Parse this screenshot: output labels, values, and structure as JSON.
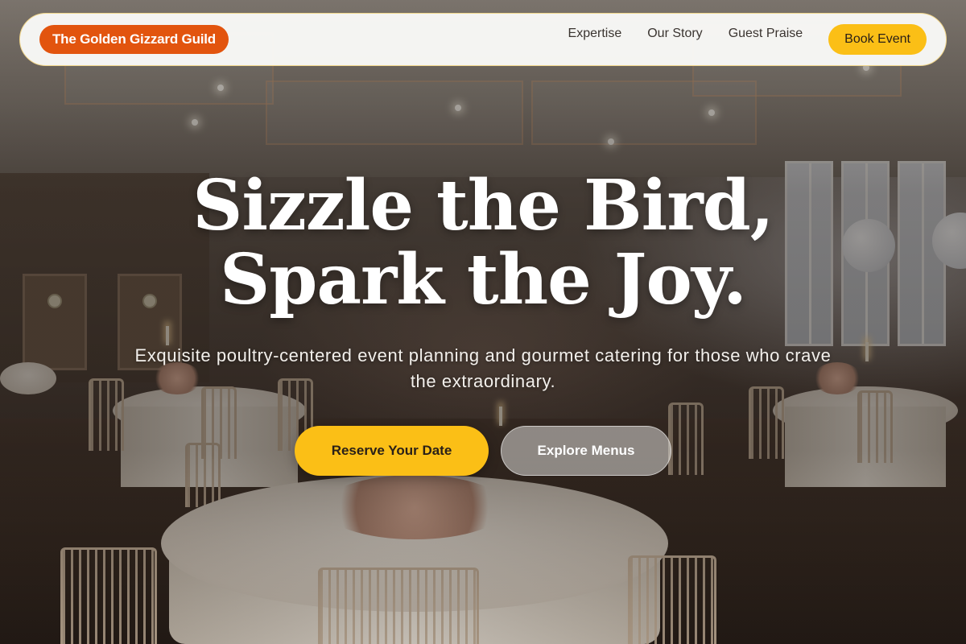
{
  "nav": {
    "brand": "The Golden Gizzard Guild",
    "links": [
      "Expertise",
      "Our Story",
      "Guest Praise"
    ],
    "cta": "Book Event"
  },
  "hero": {
    "title_line1": "Sizzle the Bird,",
    "title_line2": "Spark the Joy.",
    "subtitle": "Exquisite poultry-centered event planning and gourmet catering for those who crave the extraordinary.",
    "primary_button": "Reserve Your Date",
    "secondary_button": "Explore Menus",
    "background_image": "banquet-hall-photo"
  },
  "colors": {
    "brand_orange": "#e2540e",
    "accent_yellow": "#fbbf16",
    "nav_bg": "#fafaf8"
  }
}
